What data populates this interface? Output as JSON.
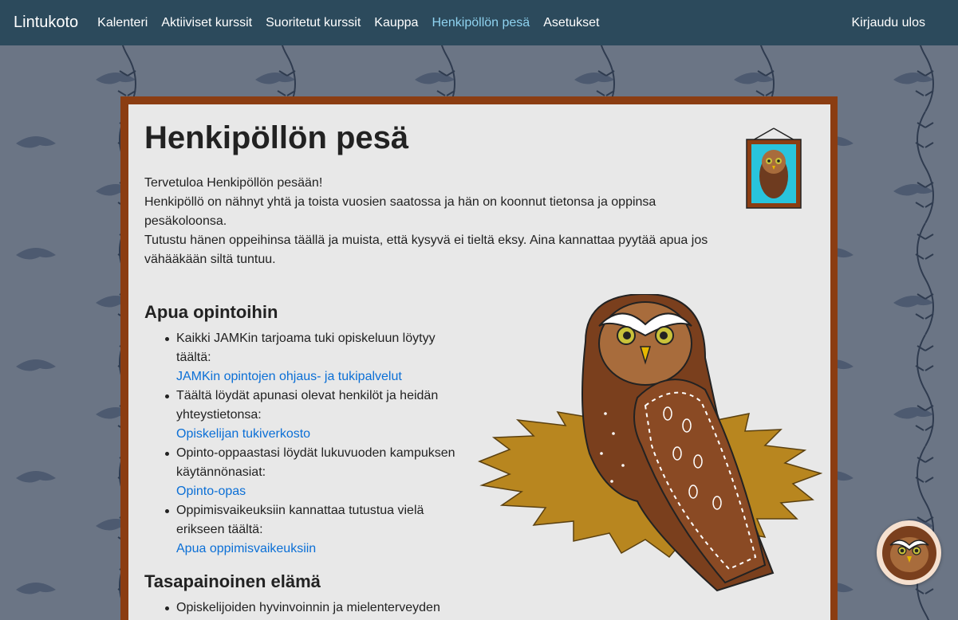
{
  "nav": {
    "brand": "Lintukoto",
    "items": [
      {
        "label": "Kalenteri",
        "active": false
      },
      {
        "label": "Aktiiviset kurssit",
        "active": false
      },
      {
        "label": "Suoritetut kurssit",
        "active": false
      },
      {
        "label": "Kauppa",
        "active": false
      },
      {
        "label": "Henkipöllön pesä",
        "active": true
      },
      {
        "label": "Asetukset",
        "active": false
      }
    ],
    "logout": "Kirjaudu ulos"
  },
  "page": {
    "title": "Henkipöllön pesä",
    "intro": [
      "Tervetuloa Henkipöllön pesään!",
      "Henkipöllö on nähnyt yhtä ja toista vuosien saatossa ja hän on koonnut tietonsa ja oppinsa pesäkoloonsa.",
      "Tutustu hänen oppeihinsa täällä ja muista, että kysyvä ei tieltä eksy. Aina kannattaa pyytää apua jos vähääkään siltä tuntuu."
    ]
  },
  "sections": [
    {
      "heading": "Apua opintoihin",
      "items": [
        {
          "text": "Kaikki JAMKin tarjoama tuki opiskeluun löytyy täältä:",
          "link": "JAMKin opintojen ohjaus- ja tukipalvelut"
        },
        {
          "text": "Täältä löydät apunasi olevat henkilöt ja heidän yhteystietonsa:",
          "link": "Opiskelijan tukiverkosto"
        },
        {
          "text": "Opinto-oppaastasi löydät lukuvuoden kampuksen käytännönasiat:",
          "link": "Opinto-opas"
        },
        {
          "text": "Oppimisvaikeuksiin kannattaa tutustua vielä erikseen täältä:",
          "link": "Apua oppimisvaikeuksiin"
        }
      ]
    },
    {
      "heading": "Tasapainoinen elämä",
      "items": [
        {
          "text": "Opiskelijoiden hyvinvoinnin ja mielenterveyden",
          "link": ""
        }
      ]
    }
  ],
  "colors": {
    "navbar": "#2c4a5c",
    "active_link": "#8fd3f0",
    "link": "#0b6fd6",
    "frame": "#8b3d12",
    "panel": "#e8e8e8",
    "background": "#6b7585"
  },
  "icons": {
    "portrait": "owl-portrait-icon",
    "mascot": "owl-mascot-icon",
    "avatar": "owl-avatar-icon"
  }
}
